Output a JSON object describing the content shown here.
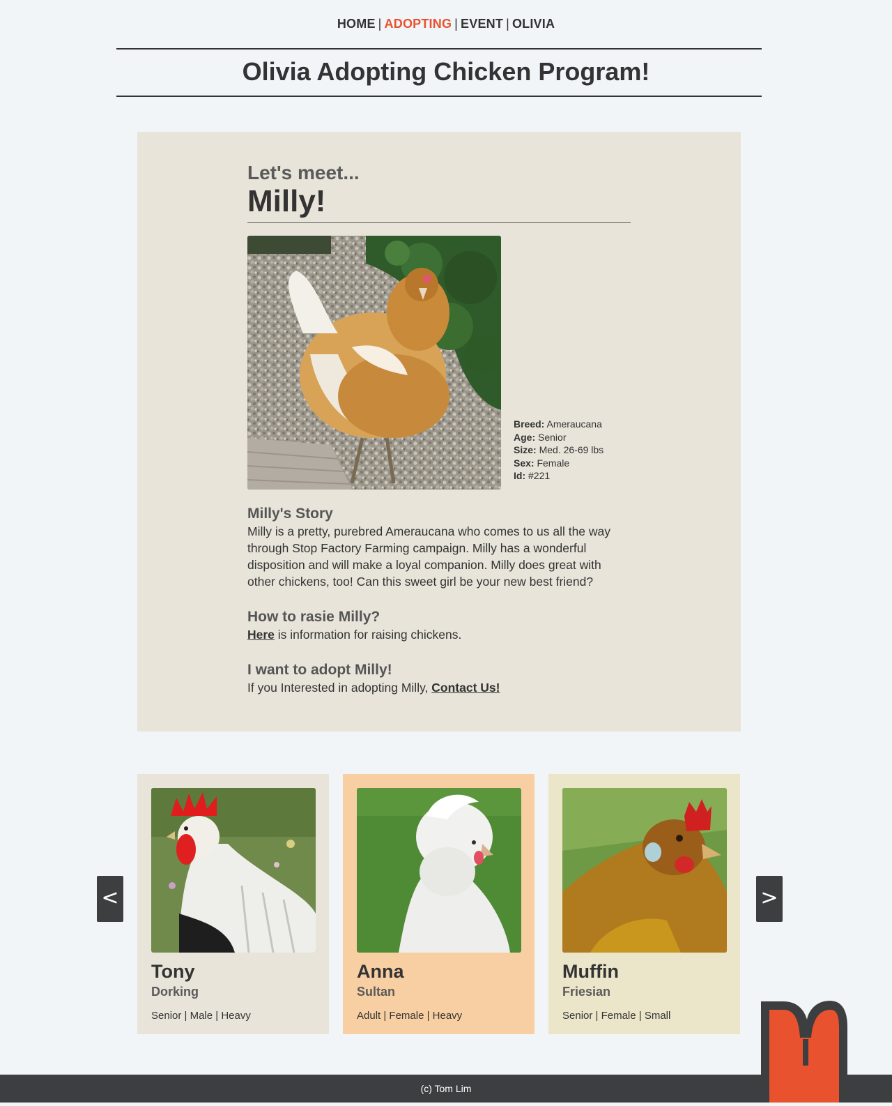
{
  "nav": {
    "items": [
      {
        "label": "HOME",
        "active": false
      },
      {
        "label": "ADOPTING",
        "active": true
      },
      {
        "label": "EVENT",
        "active": false
      },
      {
        "label": "OLIVIA",
        "active": false
      }
    ],
    "separator": "|",
    "active_color": "#e8522f"
  },
  "page_title": "Olivia Adopting Chicken Program!",
  "feature": {
    "intro": "Let's meet...",
    "name": "Milly!",
    "photo_icon": "chicken-photo",
    "facts": [
      {
        "label": "Breed:",
        "value": "Ameraucana"
      },
      {
        "label": "Age:",
        "value": "Senior"
      },
      {
        "label": "Size:",
        "value": "Med. 26-69 lbs"
      },
      {
        "label": "Sex:",
        "value": "Female"
      },
      {
        "label": "Id:",
        "value": "#221"
      }
    ],
    "story": {
      "heading": "Milly's Story",
      "text": "Milly is a pretty, purebred Ameraucana who comes to us all the way through Stop Factory Farming campaign. Milly has a wonderful disposition and will make a loyal companion. Milly does great with other chickens, too! Can this sweet girl be your new best friend?"
    },
    "raise": {
      "heading": "How to rasie Milly?",
      "link": "Here",
      "text": " is information for raising chickens."
    },
    "adopt": {
      "heading": "I want to adopt Milly!",
      "text": "If you Interested in adopting Milly, ",
      "link": "Contact Us!"
    }
  },
  "carousel": {
    "prev_label": "<",
    "next_label": ">",
    "cards": [
      {
        "name": "Tony",
        "breed": "Dorking",
        "info": "Senior | Male | Heavy",
        "bg": "#e8e4da"
      },
      {
        "name": "Anna",
        "breed": "Sultan",
        "info": "Adult | Female | Heavy",
        "bg": "#f8cfa3"
      },
      {
        "name": "Muffin",
        "breed": "Friesian",
        "info": "Senior | Female | Small",
        "bg": "#ebe5c9"
      }
    ]
  },
  "footer": {
    "text": "(c) Tom Lim"
  },
  "colors": {
    "background": "#f2f5f8",
    "panel": "#e8e4da",
    "dark": "#3d3e40",
    "accent": "#e8522f"
  }
}
